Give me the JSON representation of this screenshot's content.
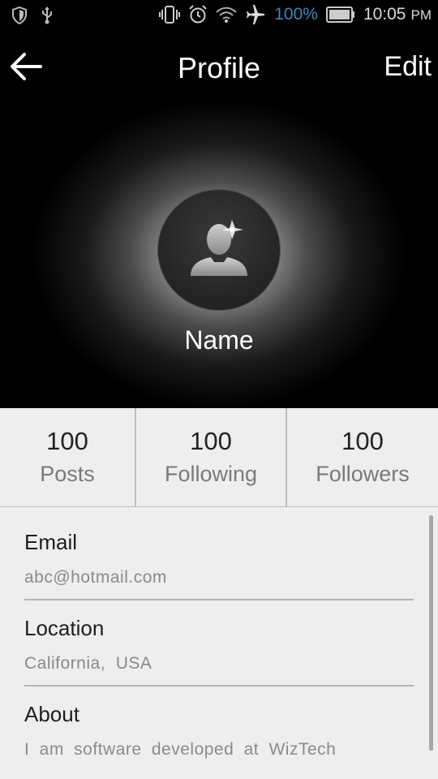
{
  "status_bar": {
    "icons_left": [
      "shield-icon",
      "usb-icon"
    ],
    "icons_right": [
      "vibrate-icon",
      "alarm-icon",
      "wifi-icon",
      "airplane-icon"
    ],
    "battery_percent": "100%",
    "time": "10:05",
    "ampm": "PM",
    "accent_color": "#3a88c0"
  },
  "appbar": {
    "title": "Profile",
    "edit_label": "Edit",
    "back_icon": "arrow-left-icon"
  },
  "profile": {
    "avatar_icon": "user-silhouette-icon",
    "name": "Name"
  },
  "stats": [
    {
      "value": "100",
      "label": "Posts"
    },
    {
      "value": "100",
      "label": "Following"
    },
    {
      "value": "100",
      "label": "Followers"
    }
  ],
  "details": {
    "email_label": "Email",
    "email_value": "abc@hotmail.com",
    "location_label": "Location",
    "location_value": "California,  USA",
    "about_label": "About",
    "about_value": "I am software developed at WizTech"
  }
}
